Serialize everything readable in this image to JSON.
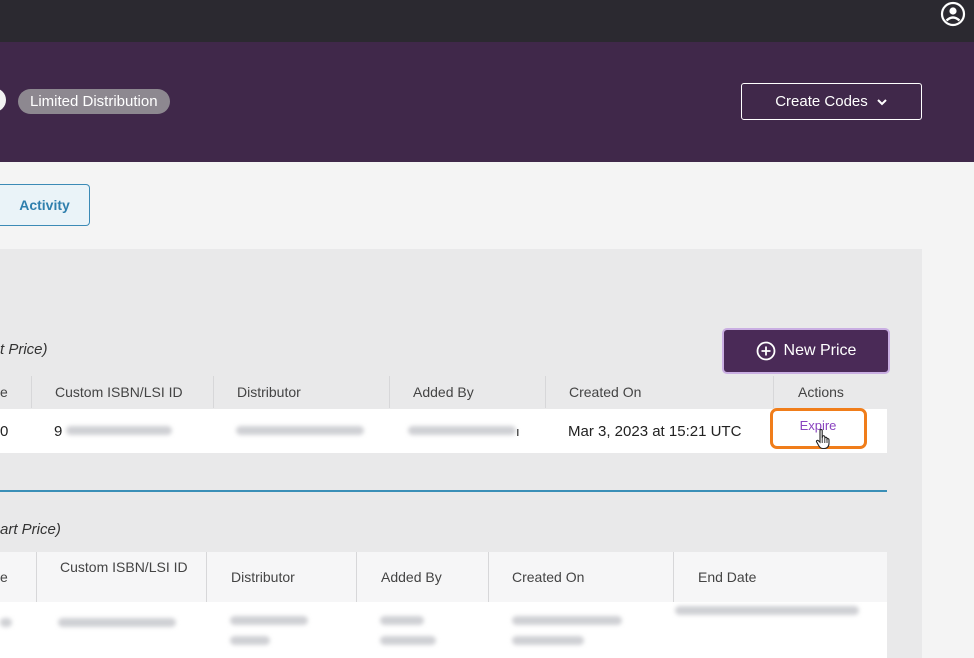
{
  "header": {
    "badge": "Limited Distribution",
    "create_codes_label": "Create Codes"
  },
  "tabs": {
    "activity_label": "Activity"
  },
  "section1": {
    "title": "t Price)",
    "new_price_label": "New Price",
    "columns": [
      "e",
      "Custom ISBN/LSI ID",
      "Distributor",
      "Added By",
      "Created On",
      "Actions"
    ],
    "row": {
      "col1": "0",
      "col2": "9",
      "col5": "ı",
      "created_on": "Mar 3, 2023 at 15:21 UTC",
      "action": "Expire"
    }
  },
  "section2": {
    "title": "art Price)",
    "columns": [
      "e",
      "Custom ISBN/LSI ID",
      "Distributor",
      "Added By",
      "Created On",
      "End Date"
    ]
  },
  "colors": {
    "topbar": "#2b2930",
    "header": "#40284a",
    "accent_blue": "#3a8fb7",
    "highlight_orange": "#f07d1a",
    "link_purple": "#8a44c0"
  }
}
